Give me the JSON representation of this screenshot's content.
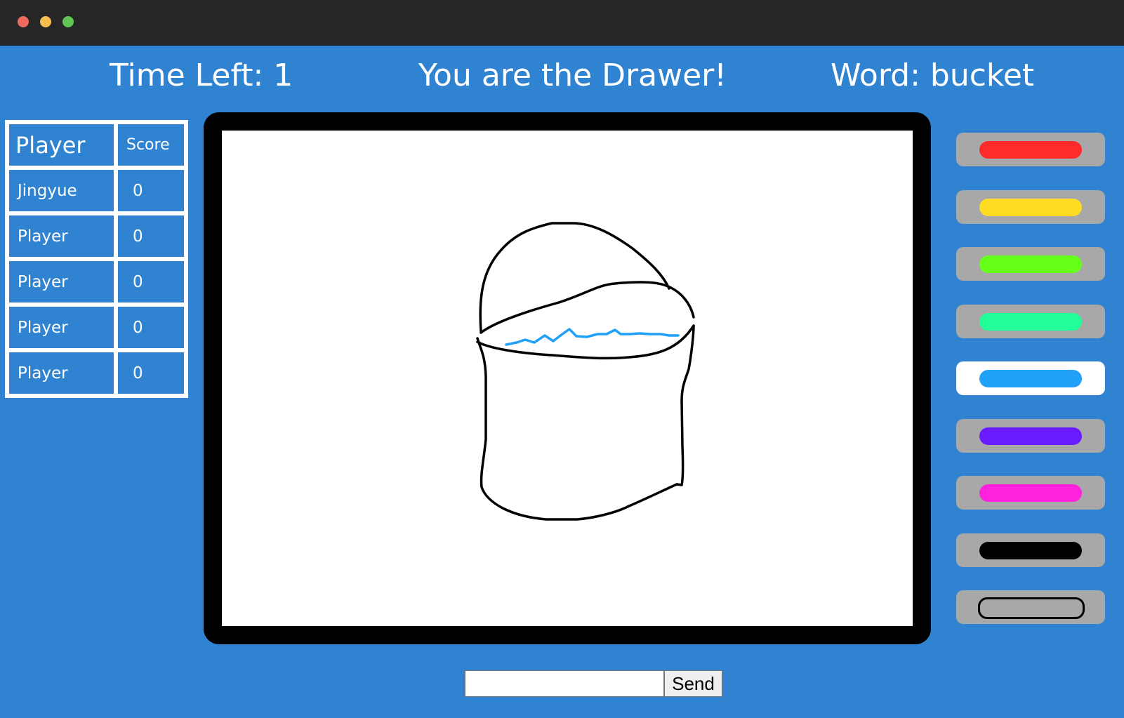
{
  "header": {
    "time_left": "Time Left: 1",
    "role_message": "You are the Drawer!",
    "word": "Word: bucket"
  },
  "scoreboard": {
    "headers": {
      "player": "Player",
      "score": "Score"
    },
    "rows": [
      {
        "name": "Jingyue",
        "score": "0"
      },
      {
        "name": "Player",
        "score": "0"
      },
      {
        "name": "Player",
        "score": "0"
      },
      {
        "name": "Player",
        "score": "0"
      },
      {
        "name": "Player",
        "score": "0"
      }
    ]
  },
  "palette": {
    "colors": [
      {
        "name": "red",
        "hex": "#ff2a2a"
      },
      {
        "name": "yellow",
        "hex": "#ffdc24"
      },
      {
        "name": "green",
        "hex": "#66ff1a"
      },
      {
        "name": "mint",
        "hex": "#22ff99"
      },
      {
        "name": "blue",
        "hex": "#21a0f7"
      },
      {
        "name": "purple",
        "hex": "#6a1aff"
      },
      {
        "name": "magenta",
        "hex": "#ff22dd"
      },
      {
        "name": "black",
        "hex": "#000000"
      },
      {
        "name": "eraser",
        "hex": "eraser-icon"
      }
    ],
    "selected": "blue"
  },
  "chat": {
    "input_value": "",
    "send_label": "Send"
  },
  "theme": {
    "background": "#3083d1",
    "titlebar": "#262626"
  }
}
